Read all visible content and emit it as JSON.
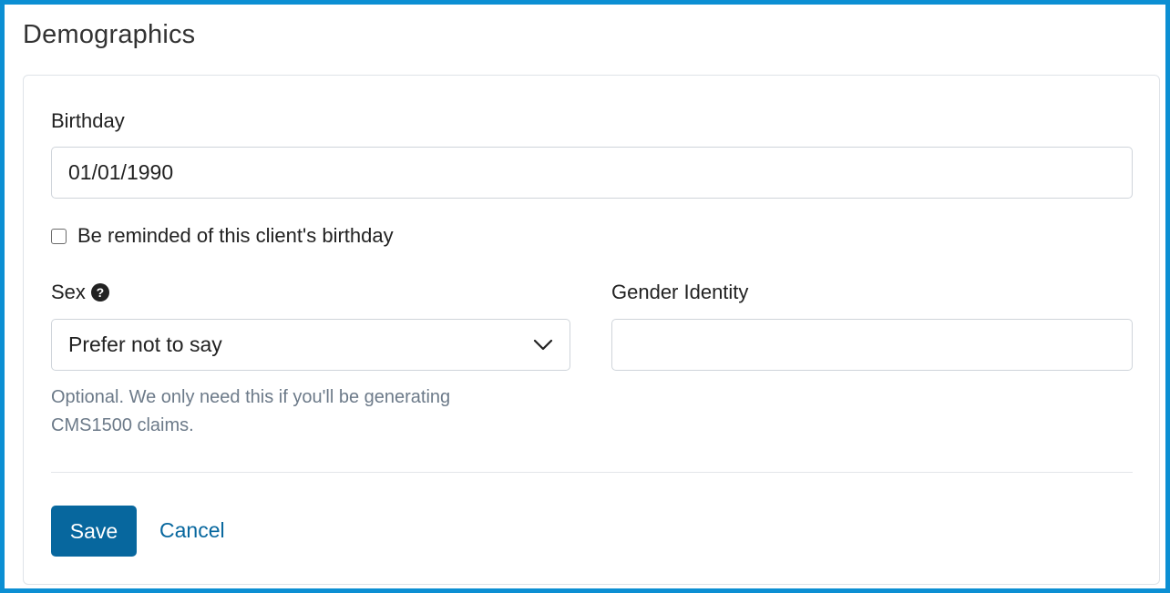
{
  "page": {
    "title": "Demographics"
  },
  "form": {
    "birthday": {
      "label": "Birthday",
      "value": "01/01/1990"
    },
    "reminder": {
      "label": "Be reminded of this client's birthday",
      "checked": false
    },
    "sex": {
      "label": "Sex",
      "help_icon": "?",
      "selected": "Prefer not to say",
      "hint": "Optional. We only need this if you'll be generating CMS1500 claims."
    },
    "gender_identity": {
      "label": "Gender Identity",
      "value": ""
    }
  },
  "actions": {
    "save_label": "Save",
    "cancel_label": "Cancel"
  },
  "colors": {
    "frame_border": "#0c8fd3",
    "primary": "#07679e",
    "hint_text": "#6c7a89"
  },
  "icons": {
    "help": "question-circle-icon",
    "select_arrow": "chevron-down-icon"
  }
}
